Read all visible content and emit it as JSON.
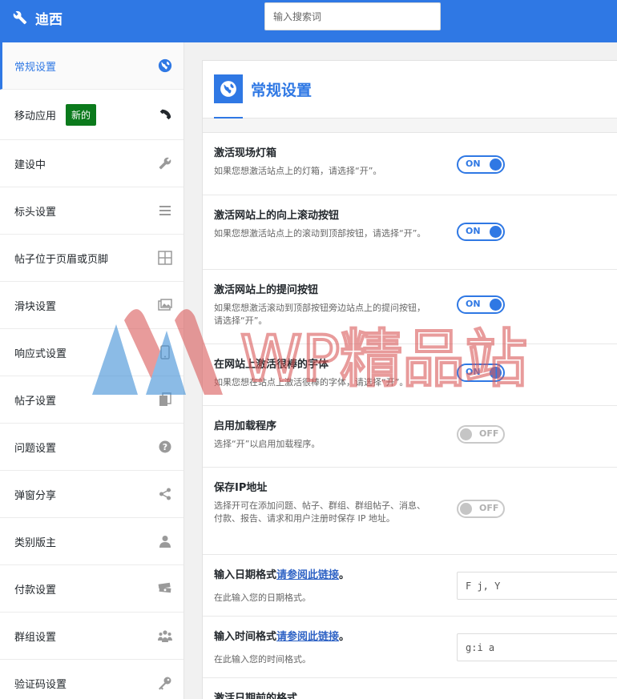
{
  "brand": {
    "name": "迪西"
  },
  "search": {
    "placeholder": "输入搜索词"
  },
  "sidebar": {
    "items": [
      {
        "label": "常规设置",
        "icon": "globe-icon"
      },
      {
        "label": "移动应用",
        "badge": "新的",
        "icon": "phone-icon"
      },
      {
        "label": "建设中",
        "icon": "wrench-icon"
      },
      {
        "label": "标头设置",
        "icon": "menu-lines-icon"
      },
      {
        "label": "帖子位于页眉或页脚",
        "icon": "grid-icon"
      },
      {
        "label": "滑块设置",
        "icon": "images-icon"
      },
      {
        "label": "响应式设置",
        "icon": "mobile-icon"
      },
      {
        "label": "帖子设置",
        "icon": "copy-icon"
      },
      {
        "label": "问题设置",
        "icon": "question-icon"
      },
      {
        "label": "弹窗分享",
        "icon": "share-icon"
      },
      {
        "label": "类别版主",
        "icon": "user-icon"
      },
      {
        "label": "付款设置",
        "icon": "money-icon"
      },
      {
        "label": "群组设置",
        "icon": "group-icon"
      },
      {
        "label": "验证码设置",
        "icon": "key-icon"
      }
    ]
  },
  "panel": {
    "title": "常规设置",
    "rows": [
      {
        "title": "激活现场灯箱",
        "desc": "如果您想激活站点上的灯箱，请选择“开”。",
        "toggle": "ON"
      },
      {
        "title": "激活网站上的向上滚动按钮",
        "desc": "如果您想激活站点上的滚动到顶部按钮，请选择“开”。",
        "toggle": "ON"
      },
      {
        "title": "激活网站上的提问按钮",
        "desc": "如果您想激活滚动到顶部按钮旁边站点上的提问按钮，请选择“开”。",
        "toggle": "ON"
      },
      {
        "title": "在网站上激活很棒的字体",
        "desc": "如果您想在站点上激活很棒的字体，请选择“开”。",
        "toggle": "ON"
      },
      {
        "title": "启用加载程序",
        "desc": "选择“开”以启用加载程序。",
        "toggle": "OFF"
      },
      {
        "title": "保存IP地址",
        "desc": "选择开可在添加问题、帖子、群组、群组帖子、消息、付款、报告、请求和用户注册时保存 IP 地址。",
        "toggle": "OFF"
      },
      {
        "title": "输入日期格式",
        "link": "请参阅此链接",
        "suffix": "。",
        "desc": "在此输入您的日期格式。",
        "value": "F j, Y"
      },
      {
        "title": "输入时间格式",
        "link": "请参阅此链接",
        "suffix": "。",
        "desc": "在此输入您的时间格式。",
        "value": "g:i a"
      },
      {
        "title": "激活日期前的格式"
      }
    ]
  },
  "watermark": {
    "text": "WP精品站"
  },
  "colors": {
    "accent": "#2f78e4",
    "badge": "#0b7a1c"
  }
}
